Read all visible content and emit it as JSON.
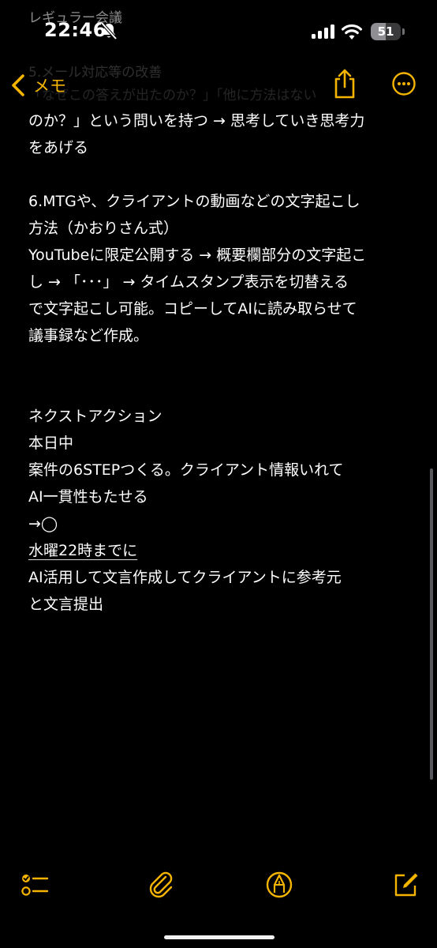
{
  "colors": {
    "accent": "#f5b400",
    "background": "#000000",
    "text": "#ffffff"
  },
  "status_bar": {
    "time": "22:46",
    "battery_level": "51",
    "icons": [
      "bell-off-icon",
      "signal-icon",
      "wifi-icon",
      "battery-icon"
    ]
  },
  "nav": {
    "back_label": "メモ",
    "ghost_lines": [
      "レギュラー会議",
      "5.メール対応等の改善",
      "「なぜこの答えが出たのか？」「他に方法はない"
    ],
    "icons": [
      "chevron-left-icon",
      "share-icon",
      "more-icon"
    ]
  },
  "note": {
    "lines": [
      "のか？」という問いを持つ → 思考していき思考力",
      "をあげる",
      "",
      "6.MTGや、クライアントの動画などの文字起こし",
      "方法（かおりさん式）",
      "YouTubeに限定公開する → 概要欄部分の文字起こ",
      "し → 「･･･」 → タイムスタンプ表示を切替える",
      "で文字起こし可能。コピーしてAIに読み取らせて",
      "議事録など作成。",
      "",
      "",
      "ネクストアクション",
      "本日中",
      "案件の6STEPつくる。クライアント情報いれて",
      "AI一貫性もたせる",
      "→◯",
      "水曜22時までに",
      "AI活用して文言作成してクライアントに参考元",
      "と文言提出"
    ]
  },
  "toolbar": {
    "icons": [
      "checklist-icon",
      "attachment-icon",
      "markup-icon",
      "compose-icon"
    ]
  }
}
